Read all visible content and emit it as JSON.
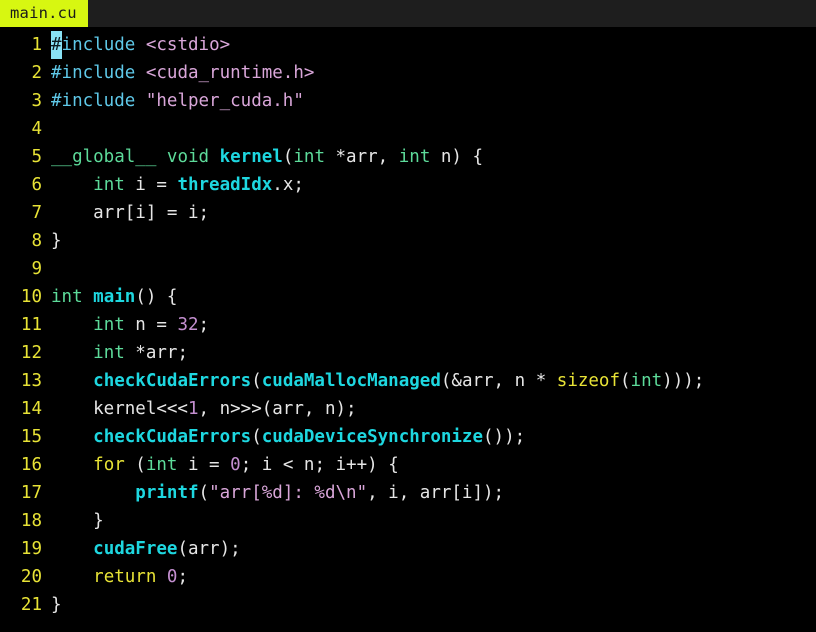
{
  "window": {
    "title": "main.cu",
    "background_color": "#000000"
  },
  "tab_bar": {
    "background_color": "#1e1e1e",
    "tabs": [
      {
        "label": "main.cu",
        "active": true,
        "background_color": "#d7f711",
        "text_color": "#1a1a1a"
      }
    ]
  },
  "editor": {
    "language": "cuda-cpp",
    "cursor": {
      "line": 1,
      "column": 1,
      "character": "#"
    },
    "gutter_color": "#e8e336",
    "colors": {
      "preprocessor": "#5fc8e8",
      "string": "#d9a6d9",
      "type": "#5ddb9a",
      "function": "#1ed7e0",
      "keyword": "#e8e336",
      "number": "#c48fd0",
      "plain": "#e6e6e6",
      "cursor": "#89e2f5"
    },
    "lines": [
      {
        "number": "1",
        "text": "#include <cstdio>"
      },
      {
        "number": "2",
        "text": "#include <cuda_runtime.h>"
      },
      {
        "number": "3",
        "text": "#include \"helper_cuda.h\""
      },
      {
        "number": "4",
        "text": ""
      },
      {
        "number": "5",
        "text": "__global__ void kernel(int *arr, int n) {"
      },
      {
        "number": "6",
        "text": "    int i = threadIdx.x;"
      },
      {
        "number": "7",
        "text": "    arr[i] = i;"
      },
      {
        "number": "8",
        "text": "}"
      },
      {
        "number": "9",
        "text": ""
      },
      {
        "number": "10",
        "text": "int main() {"
      },
      {
        "number": "11",
        "text": "    int n = 32;"
      },
      {
        "number": "12",
        "text": "    int *arr;"
      },
      {
        "number": "13",
        "text": "    checkCudaErrors(cudaMallocManaged(&arr, n * sizeof(int)));"
      },
      {
        "number": "14",
        "text": "    kernel<<<1, n>>>(arr, n);"
      },
      {
        "number": "15",
        "text": "    checkCudaErrors(cudaDeviceSynchronize());"
      },
      {
        "number": "16",
        "text": "    for (int i = 0; i < n; i++) {"
      },
      {
        "number": "17",
        "text": "        printf(\"arr[%d]: %d\\n\", i, arr[i]);"
      },
      {
        "number": "18",
        "text": "    }"
      },
      {
        "number": "19",
        "text": "    cudaFree(arr);"
      },
      {
        "number": "20",
        "text": "    return 0;"
      },
      {
        "number": "21",
        "text": "}"
      }
    ],
    "line_tokens": [
      [
        {
          "t": "#",
          "c": "cursor"
        },
        {
          "t": "include",
          "c": "pre"
        },
        {
          "t": " ",
          "c": "plain"
        },
        {
          "t": "<cstdio>",
          "c": "str"
        }
      ],
      [
        {
          "t": "#include",
          "c": "pre"
        },
        {
          "t": " ",
          "c": "plain"
        },
        {
          "t": "<cuda_runtime.h>",
          "c": "str"
        }
      ],
      [
        {
          "t": "#include",
          "c": "pre"
        },
        {
          "t": " ",
          "c": "plain"
        },
        {
          "t": "\"helper_cuda.h\"",
          "c": "str"
        }
      ],
      [],
      [
        {
          "t": "__global__",
          "c": "type"
        },
        {
          "t": " ",
          "c": "plain"
        },
        {
          "t": "void",
          "c": "type"
        },
        {
          "t": " ",
          "c": "plain"
        },
        {
          "t": "kernel",
          "c": "fn"
        },
        {
          "t": "(",
          "c": "plain"
        },
        {
          "t": "int",
          "c": "type"
        },
        {
          "t": " *arr, ",
          "c": "plain"
        },
        {
          "t": "int",
          "c": "type"
        },
        {
          "t": " n) {",
          "c": "plain"
        }
      ],
      [
        {
          "t": "    ",
          "c": "plain"
        },
        {
          "t": "int",
          "c": "type"
        },
        {
          "t": " i = ",
          "c": "plain"
        },
        {
          "t": "threadIdx",
          "c": "var"
        },
        {
          "t": ".x;",
          "c": "plain"
        }
      ],
      [
        {
          "t": "    arr[i] = i;",
          "c": "plain"
        }
      ],
      [
        {
          "t": "}",
          "c": "plain"
        }
      ],
      [],
      [
        {
          "t": "int",
          "c": "type"
        },
        {
          "t": " ",
          "c": "plain"
        },
        {
          "t": "main",
          "c": "fn"
        },
        {
          "t": "() {",
          "c": "plain"
        }
      ],
      [
        {
          "t": "    ",
          "c": "plain"
        },
        {
          "t": "int",
          "c": "type"
        },
        {
          "t": " n = ",
          "c": "plain"
        },
        {
          "t": "32",
          "c": "num"
        },
        {
          "t": ";",
          "c": "plain"
        }
      ],
      [
        {
          "t": "    ",
          "c": "plain"
        },
        {
          "t": "int",
          "c": "type"
        },
        {
          "t": " *arr;",
          "c": "plain"
        }
      ],
      [
        {
          "t": "    ",
          "c": "plain"
        },
        {
          "t": "checkCudaErrors",
          "c": "fn"
        },
        {
          "t": "(",
          "c": "plain"
        },
        {
          "t": "cudaMallocManaged",
          "c": "fn"
        },
        {
          "t": "(&arr, n * ",
          "c": "plain"
        },
        {
          "t": "sizeof",
          "c": "kw"
        },
        {
          "t": "(",
          "c": "plain"
        },
        {
          "t": "int",
          "c": "type"
        },
        {
          "t": ")));",
          "c": "plain"
        }
      ],
      [
        {
          "t": "    kernel<<<",
          "c": "plain"
        },
        {
          "t": "1",
          "c": "num"
        },
        {
          "t": ", n>>>(arr, n);",
          "c": "plain"
        }
      ],
      [
        {
          "t": "    ",
          "c": "plain"
        },
        {
          "t": "checkCudaErrors",
          "c": "fn"
        },
        {
          "t": "(",
          "c": "plain"
        },
        {
          "t": "cudaDeviceSynchronize",
          "c": "fn"
        },
        {
          "t": "());",
          "c": "plain"
        }
      ],
      [
        {
          "t": "    ",
          "c": "plain"
        },
        {
          "t": "for",
          "c": "kw"
        },
        {
          "t": " (",
          "c": "plain"
        },
        {
          "t": "int",
          "c": "type"
        },
        {
          "t": " i = ",
          "c": "plain"
        },
        {
          "t": "0",
          "c": "num"
        },
        {
          "t": "; i < n; i++) {",
          "c": "plain"
        }
      ],
      [
        {
          "t": "        ",
          "c": "plain"
        },
        {
          "t": "printf",
          "c": "fn"
        },
        {
          "t": "(",
          "c": "plain"
        },
        {
          "t": "\"arr[%d]: %d\\n\"",
          "c": "str"
        },
        {
          "t": ", i, arr[i]);",
          "c": "plain"
        }
      ],
      [
        {
          "t": "    }",
          "c": "plain"
        }
      ],
      [
        {
          "t": "    ",
          "c": "plain"
        },
        {
          "t": "cudaFree",
          "c": "fn"
        },
        {
          "t": "(arr);",
          "c": "plain"
        }
      ],
      [
        {
          "t": "    ",
          "c": "plain"
        },
        {
          "t": "return",
          "c": "kw"
        },
        {
          "t": " ",
          "c": "plain"
        },
        {
          "t": "0",
          "c": "num"
        },
        {
          "t": ";",
          "c": "plain"
        }
      ],
      [
        {
          "t": "}",
          "c": "plain"
        }
      ]
    ]
  }
}
